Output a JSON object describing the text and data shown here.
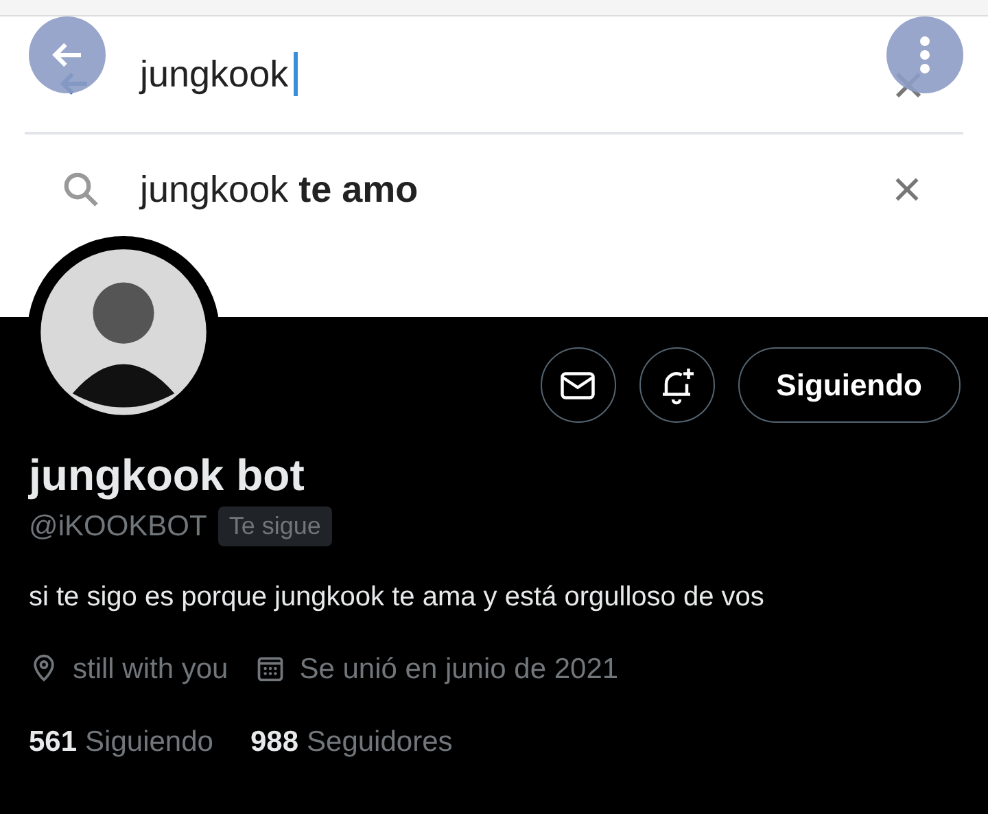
{
  "banner": {
    "kind": "screenshot",
    "search": {
      "value": "jungkook"
    },
    "suggestion": {
      "text": "jungkook **te amo**"
    }
  },
  "actions": {
    "follow_button": "Siguiendo",
    "notifications_on": false
  },
  "profile": {
    "name": "jungkook bot",
    "handle": "@iKOOKBOT",
    "follows_you_badge": "Te sigue",
    "bio": "si te sigo es porque jungkook te ama y está orgulloso de vos",
    "location": "still with you",
    "joined": "Se unió en junio de 2021"
  },
  "stats": [
    {
      "count": "561",
      "label": "Siguiendo"
    },
    {
      "count": "988",
      "label": "Seguidores"
    }
  ]
}
